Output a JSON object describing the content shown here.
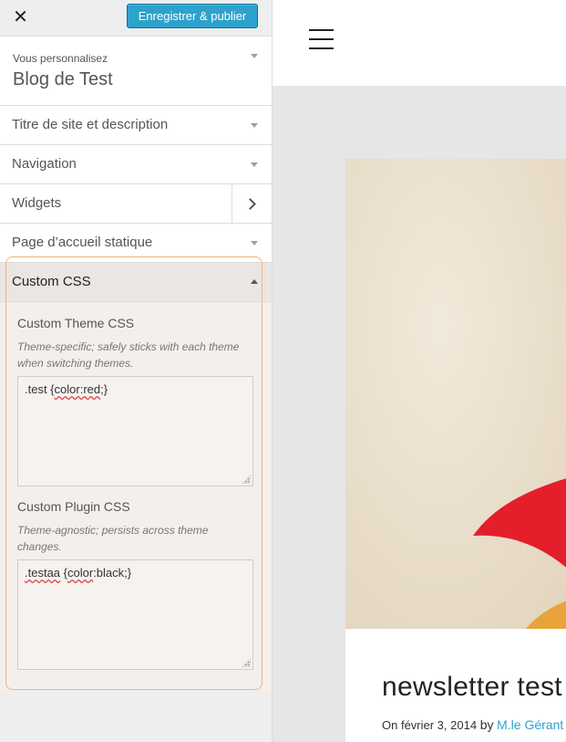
{
  "topbar": {
    "close_glyph": "✕",
    "publish_label": "Enregistrer & publier"
  },
  "site_box": {
    "caption": "Vous personnalisez",
    "blog_name": "Blog de Test"
  },
  "sections": {
    "titre": "Titre de site et description",
    "navigation": "Navigation",
    "widgets": "Widgets",
    "page_accueil": "Page d’accueil statique",
    "custom_css": "Custom CSS"
  },
  "custom_css": {
    "theme_title": "Custom Theme CSS",
    "theme_desc": "Theme-specific; safely sticks with each theme when switching themes.",
    "theme_value_plain": ".test {",
    "theme_value_squig": "color:red",
    "theme_value_end": ";}",
    "plugin_title": "Custom Plugin CSS",
    "plugin_desc": "Theme-agnostic; persists across theme changes.",
    "plugin_value_squig1": ".testaa",
    "plugin_value_mid": " {",
    "plugin_value_squig2": "color",
    "plugin_value_end": ":black;}"
  },
  "preview": {
    "post_title": "newsletter test",
    "meta_date": "On février 3, 2014",
    "meta_by": "by",
    "meta_author": "M.le Gérant"
  },
  "colors": {
    "accent": "#2ea2cc",
    "highlight": "#f2b27a",
    "image_red": "#e41e2b",
    "image_orange": "#e8a33a"
  }
}
